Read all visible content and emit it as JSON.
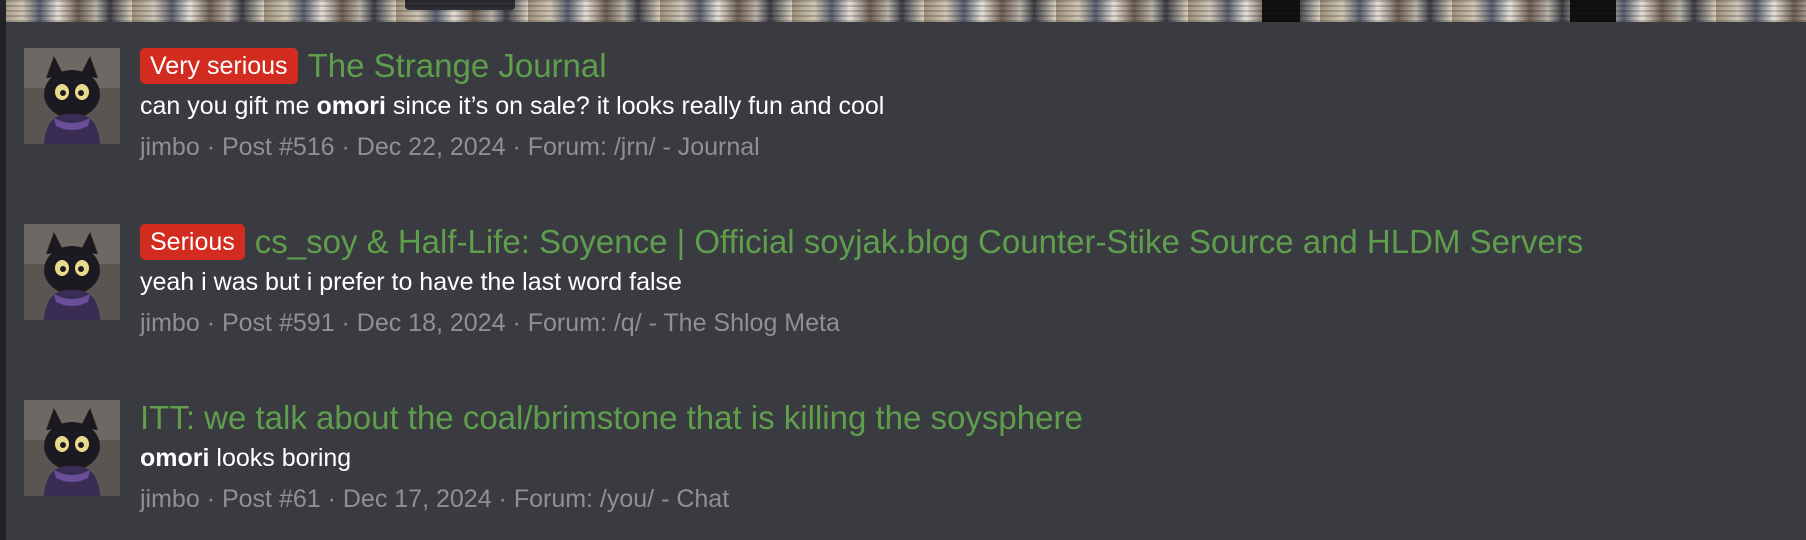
{
  "results": [
    {
      "prefix": "Very serious",
      "title": "The Strange Journal",
      "snippet_before": "can you gift me ",
      "snippet_bold": "omori",
      "snippet_after": " since it’s on sale? it looks really fun and cool",
      "author": "jimbo",
      "post": "Post #516",
      "date": "Dec 22, 2024",
      "forum": "Forum: /jrn/ - Journal"
    },
    {
      "prefix": "Serious",
      "title": "cs_soy & Half-Life: Soyence | Official soyjak.blog Counter-Stike Source and HLDM Servers",
      "snippet_before": "yeah i was but i prefer to have the last word false",
      "snippet_bold": "",
      "snippet_after": "",
      "author": "jimbo",
      "post": "Post #591",
      "date": "Dec 18, 2024",
      "forum": "Forum: /q/ - The Shlog Meta"
    },
    {
      "prefix": "",
      "title": "ITT: we talk about the coal/brimstone that is killing the soysphere",
      "snippet_before": "",
      "snippet_bold": "omori",
      "snippet_after": " looks boring",
      "author": "jimbo",
      "post": "Post #61",
      "date": "Dec 17, 2024",
      "forum": "Forum: /you/ - Chat"
    }
  ],
  "separator": " · ",
  "colors": {
    "background": "#393b40",
    "link_green": "#5f9e4d",
    "prefix_red": "#d22c20",
    "meta_gray": "#8e9096"
  }
}
